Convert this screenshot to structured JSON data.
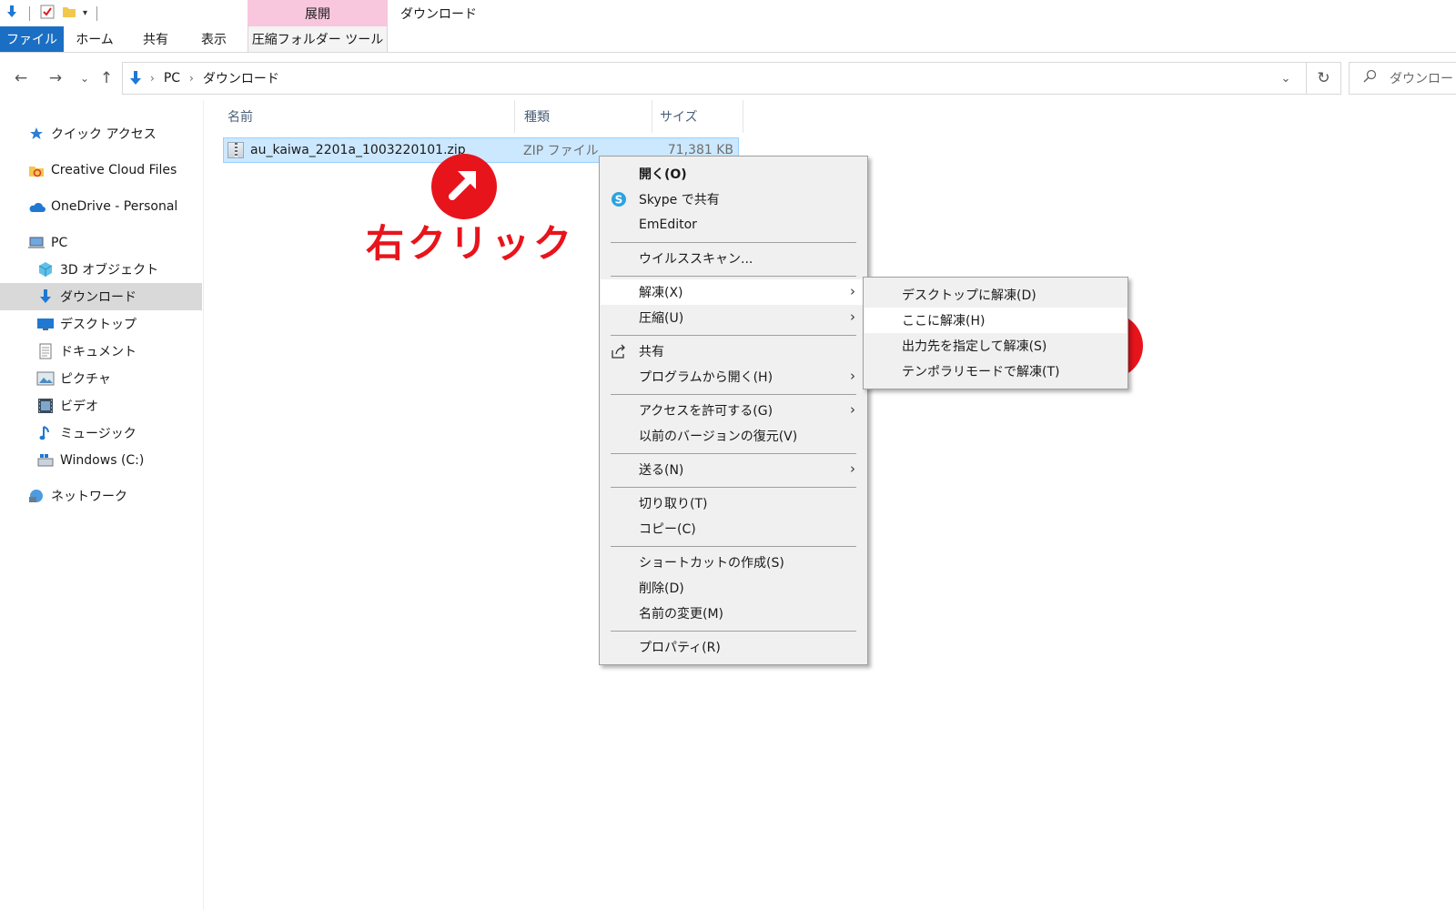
{
  "ribbon": {
    "context_label": "展開",
    "window_title": "ダウンロード",
    "tabs": [
      "ファイル",
      "ホーム",
      "共有",
      "表示",
      "圧縮フォルダー ツール"
    ]
  },
  "address": {
    "crumbs": [
      "PC",
      "ダウンロード"
    ],
    "search_placeholder": "ダウンロード"
  },
  "sidebar": {
    "items": [
      {
        "label": "クイック アクセス",
        "icon": "star-icon"
      },
      {
        "label": "Creative Cloud Files",
        "icon": "creative-cloud-icon"
      },
      {
        "label": "OneDrive - Personal",
        "icon": "cloud-icon"
      },
      {
        "label": "PC",
        "icon": "computer-icon"
      },
      {
        "label": "3D オブジェクト",
        "icon": "cube-icon"
      },
      {
        "label": "ダウンロード",
        "icon": "download-icon"
      },
      {
        "label": "デスクトップ",
        "icon": "desktop-icon"
      },
      {
        "label": "ドキュメント",
        "icon": "document-icon"
      },
      {
        "label": "ピクチャ",
        "icon": "picture-icon"
      },
      {
        "label": "ビデオ",
        "icon": "video-icon"
      },
      {
        "label": "ミュージック",
        "icon": "music-icon"
      },
      {
        "label": "Windows (C:)",
        "icon": "drive-icon"
      },
      {
        "label": "ネットワーク",
        "icon": "network-icon"
      }
    ],
    "selected": "ダウンロード"
  },
  "filelist": {
    "columns": [
      "名前",
      "種類",
      "サイズ"
    ],
    "rows": [
      {
        "name": "au_kaiwa_2201a_1003220101.zip",
        "type": "ZIP ファイル",
        "size": "71,381 KB"
      }
    ]
  },
  "annotation": {
    "right_click_text": "右クリック",
    "color": "#e8141c"
  },
  "context_menu": {
    "items": [
      "開く(O)",
      "Skype で共有",
      "EmEditor",
      "ウイルススキャン...",
      "解凍(X)",
      "圧縮(U)",
      "共有",
      "プログラムから開く(H)",
      "アクセスを許可する(G)",
      "以前のバージョンの復元(V)",
      "送る(N)",
      "切り取り(T)",
      "コピー(C)",
      "ショートカットの作成(S)",
      "削除(D)",
      "名前の変更(M)",
      "プロパティ(R)"
    ]
  },
  "submenu": {
    "items": [
      "デスクトップに解凍(D)",
      "ここに解凍(H)",
      "出力先を指定して解凍(S)",
      "テンポラリモードで解凍(T)"
    ]
  },
  "colors": {
    "accent": "#1a6fc4",
    "context_tab": "#f8c6dd",
    "selection": "#cce8ff",
    "annotation_red": "#e8141c"
  }
}
